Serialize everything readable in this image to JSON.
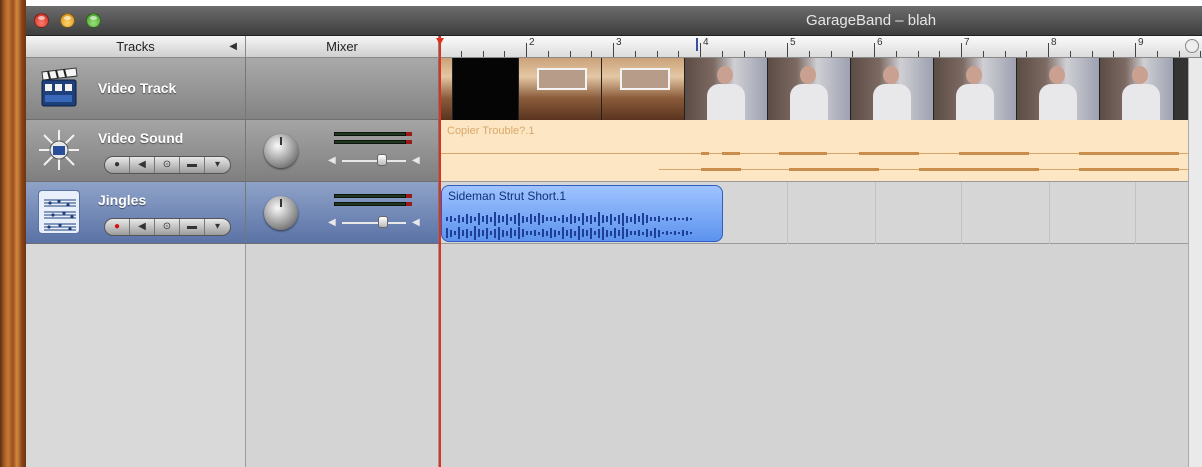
{
  "window": {
    "title": "GarageBand – blah"
  },
  "headers": {
    "tracks": "Tracks",
    "mixer": "Mixer"
  },
  "ruler": {
    "bars": [
      "2",
      "3",
      "4",
      "5",
      "6",
      "7",
      "8",
      "9"
    ]
  },
  "tracks": [
    {
      "name": "Video Track",
      "icon": "video-track-icon"
    },
    {
      "name": "Video Sound",
      "icon": "video-sound-icon",
      "region": "Copier Trouble?.1"
    },
    {
      "name": "Jingles",
      "icon": "sheet-music-icon",
      "region": "Sideman Strut Short.1"
    }
  ],
  "track_buttons": {
    "record": "●",
    "mute": "◀",
    "solo": "⊙",
    "lock": "▬",
    "options": "▾"
  },
  "colors": {
    "playhead": "#e0301e",
    "selected_track": "#5a72a6",
    "video_sound_region": "#fde6c4",
    "jingles_region": "#5c93ee"
  }
}
